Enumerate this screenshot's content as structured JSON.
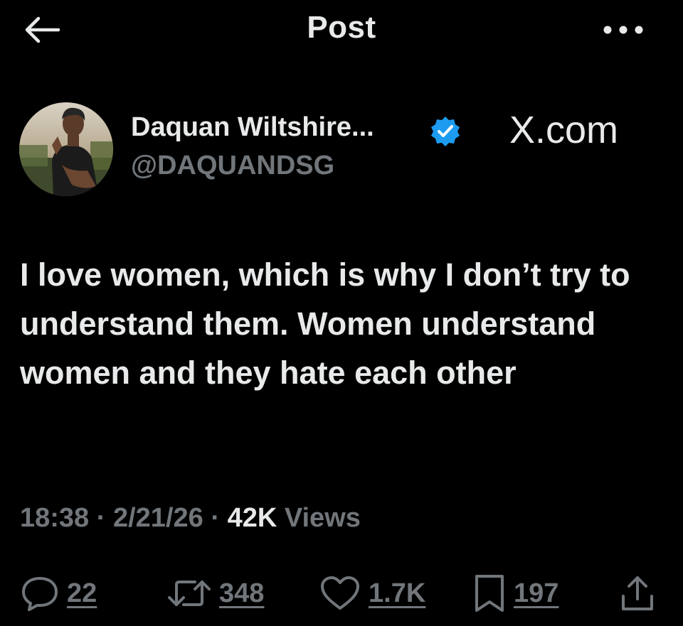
{
  "header": {
    "title": "Post",
    "back_icon": "arrow-left-icon",
    "more_icon": "more-horizontal-icon"
  },
  "author": {
    "display_name": "Daquan Wiltshire...",
    "handle": "@DAQUANDSG",
    "verified": true,
    "verified_color": "#1d9bf0"
  },
  "watermark": "X.com",
  "post": {
    "text": "I love women, which is why I don’t try to understand them. Women understand women and they hate each other"
  },
  "meta": {
    "time": "18:38",
    "separator": "·",
    "date": "2/21/26",
    "views_count": "42K",
    "views_label": "Views"
  },
  "actions": {
    "replies": {
      "icon": "reply-icon",
      "count": "22"
    },
    "reposts": {
      "icon": "repost-icon",
      "count": "348"
    },
    "likes": {
      "icon": "heart-icon",
      "count": "1.7K"
    },
    "bookmarks": {
      "icon": "bookmark-icon",
      "count": "197"
    },
    "share": {
      "icon": "share-icon"
    }
  },
  "colors": {
    "background": "#000000",
    "text_primary": "#e7e9ea",
    "text_secondary": "#71767b"
  }
}
